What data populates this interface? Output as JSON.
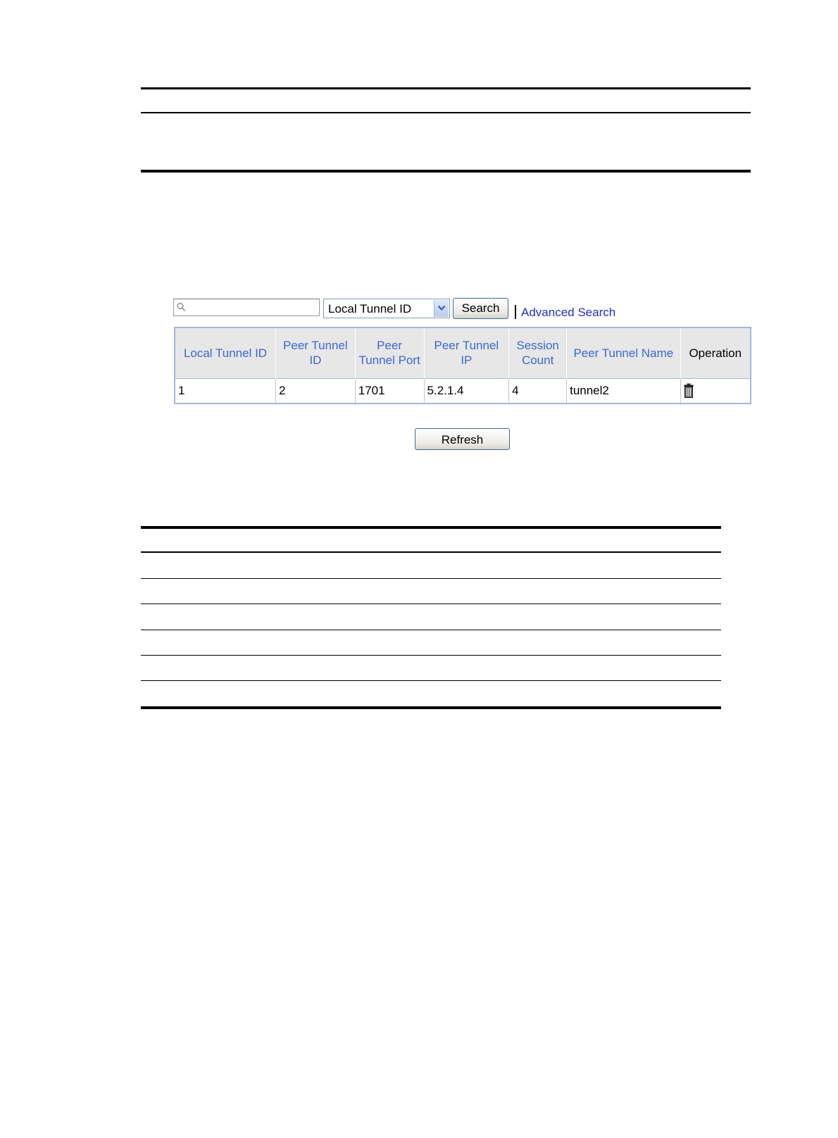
{
  "toolbar": {
    "search_value": "",
    "field_selected": "Local Tunnel ID",
    "search_label": "Search",
    "advanced_search_label": "Advanced Search"
  },
  "table": {
    "headers": [
      "Local Tunnel ID",
      "Peer Tunnel ID",
      "Peer Tunnel Port",
      "Peer Tunnel IP",
      "Session Count",
      "Peer Tunnel Name",
      "Operation"
    ],
    "rows": [
      {
        "local_tunnel_id": "1",
        "peer_tunnel_id": "2",
        "peer_tunnel_port": "1701",
        "peer_tunnel_ip": "5.2.1.4",
        "session_count": "4",
        "peer_tunnel_name": "tunnel2",
        "operation_icon": "trash-icon"
      }
    ]
  },
  "footer": {
    "refresh_label": "Refresh"
  },
  "colors": {
    "header_link": "#3b68d3",
    "link": "#1f2fc8",
    "table_border": "#a3b8de"
  }
}
